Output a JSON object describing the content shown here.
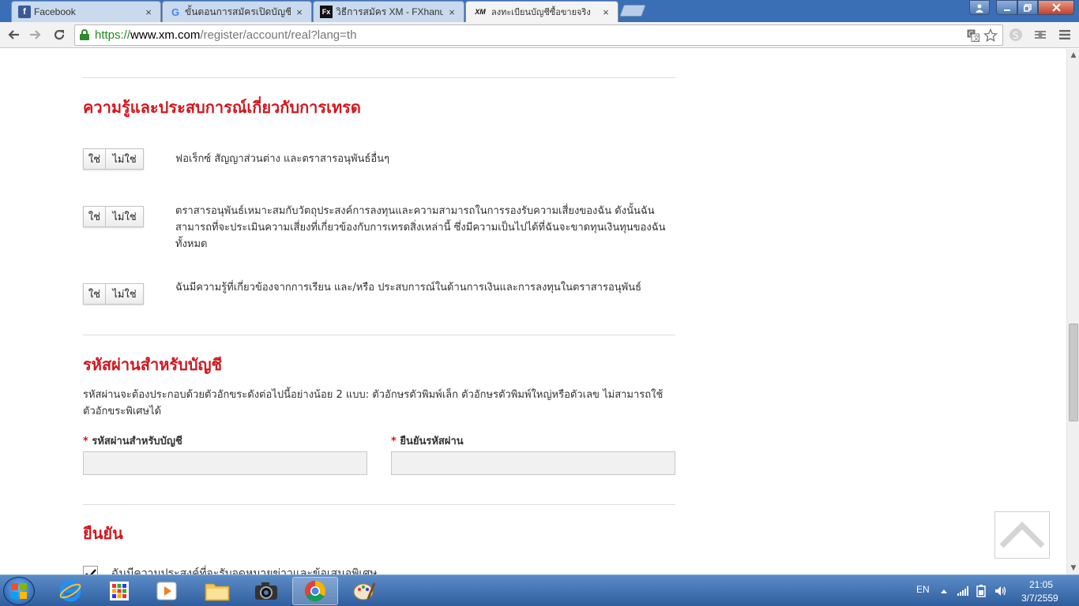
{
  "browser": {
    "tabs": [
      {
        "title": "Facebook",
        "favicon": "facebook-icon",
        "active": false
      },
      {
        "title": "ขั้นตอนการสมัครเปิดบัญชี XM",
        "favicon": "google-icon",
        "active": false
      },
      {
        "title": "วิธีการสมัคร XM - FXhanum",
        "favicon": "fx-icon",
        "active": false
      },
      {
        "title": "ลงทะเบียนบัญชีซื้อขายจริง",
        "favicon": "xm-icon",
        "active": true
      }
    ],
    "close_glyph": "×",
    "url": {
      "scheme": "https://",
      "host": "www.xm.com",
      "path": "/register/account/real?lang=th"
    }
  },
  "page": {
    "knowledge_section": {
      "title": "ความรู้และประสบการณ์เกี่ยวกับการเทรด",
      "yes_label": "ใช่",
      "no_label": "ไม่ใช่",
      "questions": [
        "ฟอเร็กซ์ สัญญาส่วนต่าง และตราสารอนุพันธ์อื่นๆ",
        "ตราสารอนุพันธ์เหมาะสมกับวัตถุประสงค์การลงทุนและความสามารถในการรองรับความเสี่ยงของฉัน ดังนั้นฉันสามารถที่จะประเมินความเสี่ยงที่เกี่ยวข้องกับการเทรดสิ่งเหล่านี้ ซึ่งมีความเป็นไปได้ที่ฉันจะขาดทุนเงินทุนของฉันทั้งหมด",
        "ฉันมีความรู้ที่เกี่ยวข้องจากการเรียน และ/หรือ ประสบการณ์ในด้านการเงินและการลงทุนในตราสารอนุพันธ์"
      ]
    },
    "password_section": {
      "title": "รหัสผ่านสำหรับบัญชี",
      "description": "รหัสผ่านจะต้องประกอบด้วยตัวอักขระดังต่อไปนี้อย่างน้อย 2 แบบ: ตัวอักษรตัวพิมพ์เล็ก ตัวอักษรตัวพิมพ์ใหญ่หรือตัวเลข ไม่สามารถใช้ตัวอักขระพิเศษได้",
      "required_mark": "*",
      "password_label": "รหัสผ่านสำหรับบัญชี",
      "password_value": "",
      "confirm_label": "ยืนยันรหัสผ่าน",
      "confirm_value": ""
    },
    "confirm_section": {
      "title": "ยืนยัน",
      "newsletter_label": "ฉันมีความประสงค์ที่จะรับจดหมายข่าวและข้อเสนอพิเศษ",
      "newsletter_checked": true
    }
  },
  "taskbar": {
    "language": "EN",
    "time": "21:05",
    "date": "3/7/2559",
    "apps": [
      "apps-grid-icon",
      "media-player-icon",
      "file-explorer-icon",
      "camera-icon",
      "chrome-icon",
      "paint-icon"
    ]
  },
  "colors": {
    "accent_red": "#d0171f",
    "title_bar_blue": "#3a6fb6",
    "url_green": "#238b23"
  }
}
